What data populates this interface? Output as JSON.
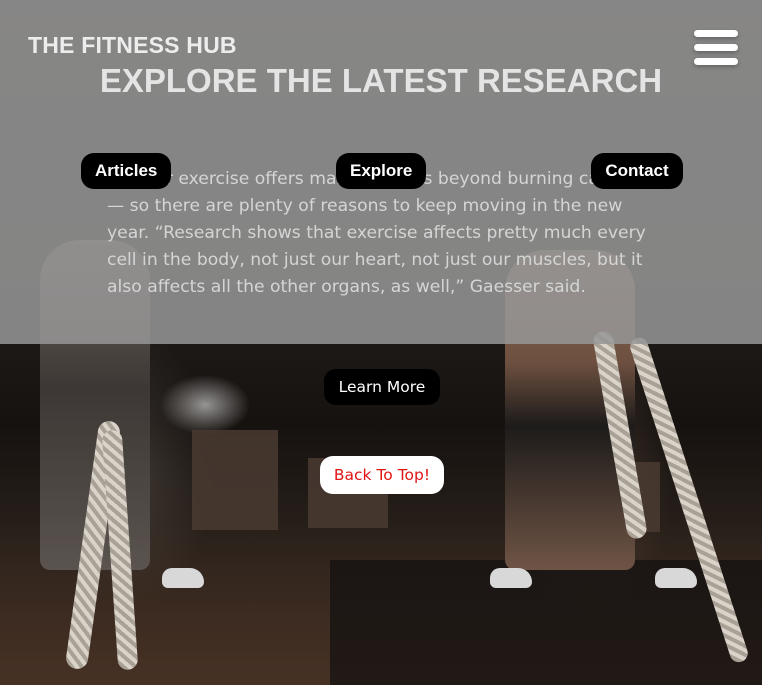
{
  "header": {
    "brand": "THE FITNESS HUB",
    "menu_icon": "hamburger-menu-icon"
  },
  "hero": {
    "title": "EXPLORE THE LATEST RESEARCH",
    "paragraph": "Regular exercise offers many benefits beyond burning calories — so there are plenty of reasons to keep moving in the new year. “Research shows that exercise affects pretty much every cell in the body, not just our heart, not just our muscles, but it also affects all the other organs, as well,” Gaesser said."
  },
  "nav": {
    "items": [
      {
        "label": "Articles"
      },
      {
        "label": "Explore"
      },
      {
        "label": "Contact"
      }
    ]
  },
  "actions": {
    "learn_more": "Learn More",
    "back_to_top": "Back To Top!"
  },
  "colors": {
    "overlay": "#969696",
    "button_dark": "#000000",
    "back_to_top_text": "#e01515"
  }
}
